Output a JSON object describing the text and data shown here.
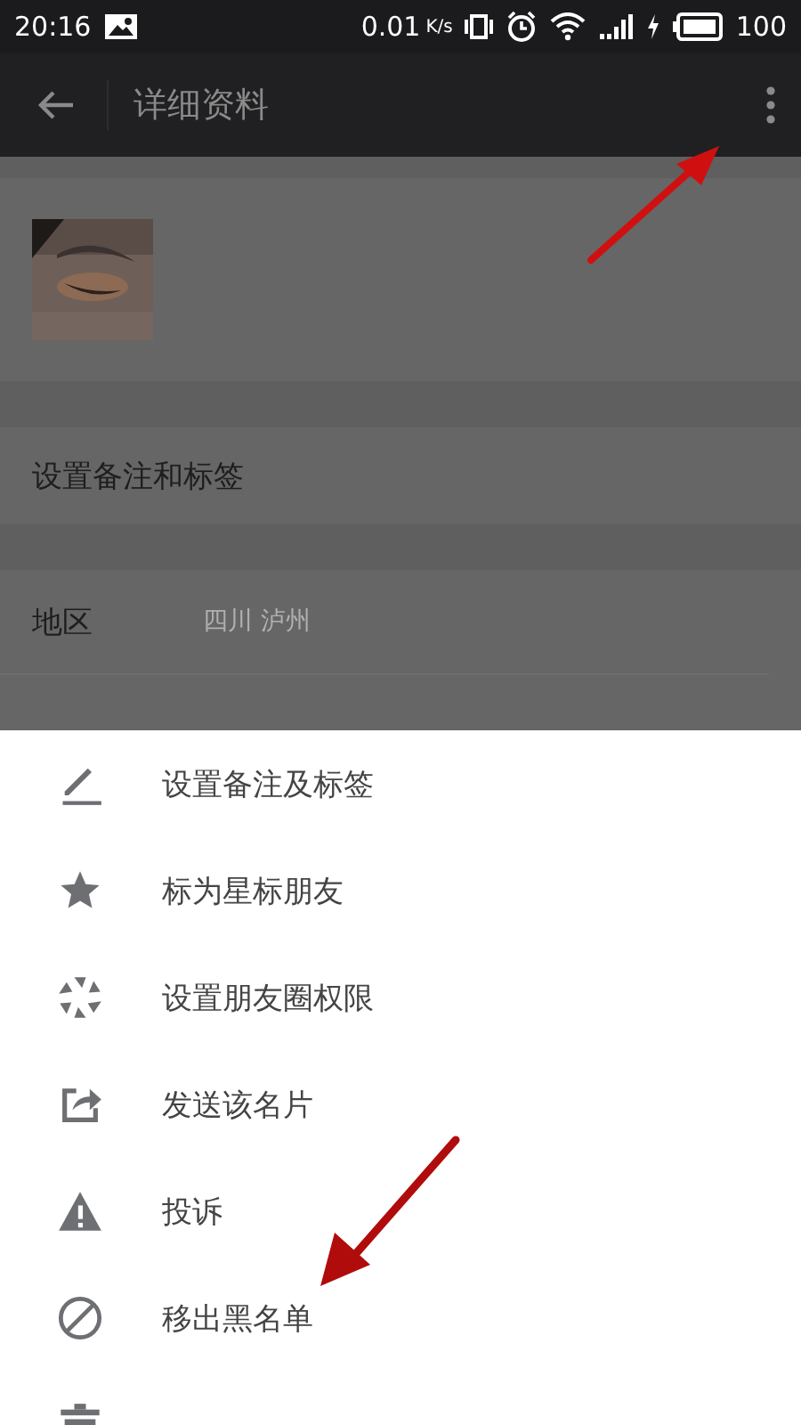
{
  "status_bar": {
    "time": "20:16",
    "speed": "0.01",
    "speed_unit": "K/s",
    "battery": "100"
  },
  "app_bar": {
    "title": "详细资料"
  },
  "profile": {
    "remark_row": "设置备注和标签",
    "fields": [
      {
        "label": "地区",
        "value": "四川  泸州"
      }
    ]
  },
  "menu": {
    "items": [
      {
        "label": "设置备注及标签"
      },
      {
        "label": "标为星标朋友"
      },
      {
        "label": "设置朋友圈权限"
      },
      {
        "label": "发送该名片"
      },
      {
        "label": "投诉"
      },
      {
        "label": "移出黑名单"
      }
    ]
  }
}
